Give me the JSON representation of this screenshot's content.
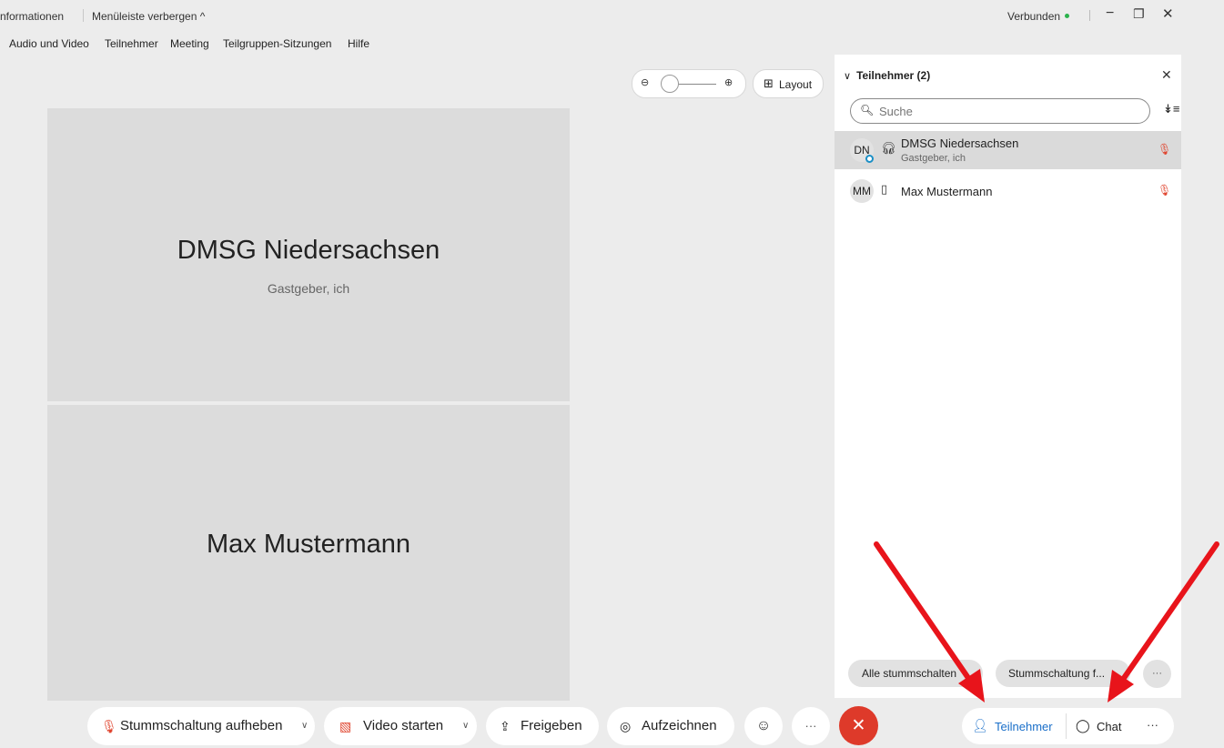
{
  "topbar": {
    "info_label": "nformationen",
    "hide_menu_label": "Menüleiste verbergen ^",
    "status_label": "Verbunden",
    "status_color": "#2bb24c",
    "minimize_icon": "−",
    "restore_icon": "❐",
    "close_icon": "✕"
  },
  "menubar": {
    "items": [
      "Audio und Video",
      "Teilnehmer",
      "Meeting",
      "Teilgruppen-Sitzungen",
      "Hilfe"
    ]
  },
  "stage": {
    "layout_label": "Layout",
    "zoom_out_icon": "zoom-out",
    "zoom_in_icon": "zoom-in",
    "tiles": [
      {
        "name": "DMSG Niedersachsen",
        "role": "Gastgeber, ich"
      },
      {
        "name": "Max Mustermann",
        "role": ""
      }
    ]
  },
  "panel": {
    "title": "Teilnehmer (2)",
    "close_icon": "✕",
    "search_placeholder": "Suche",
    "participants": [
      {
        "initials": "DN",
        "name": "DMSG Niedersachsen",
        "role": "Gastgeber, ich",
        "device_icon": "headset-icon",
        "muted": true,
        "selected": true
      },
      {
        "initials": "MM",
        "name": "Max Mustermann",
        "role": "",
        "device_icon": "phone-icon",
        "muted": true,
        "selected": false
      }
    ],
    "mute_all_label": "Alle stummschalten",
    "unmute_all_label": "Stummschaltung f...",
    "more_label": "···"
  },
  "controls": {
    "unmute_label": "Stummschaltung aufheben",
    "video_label": "Video starten",
    "share_label": "Freigeben",
    "record_label": "Aufzeichnen",
    "more_label": "···",
    "end_icon": "✕",
    "participants_label": "Teilnehmer",
    "chat_label": "Chat",
    "side_more_label": "···"
  },
  "colors": {
    "accent": "#1a6fc9",
    "end_call": "#de3a2a",
    "mute_red": "#e0452f",
    "arrow_red": "#e8141b"
  }
}
